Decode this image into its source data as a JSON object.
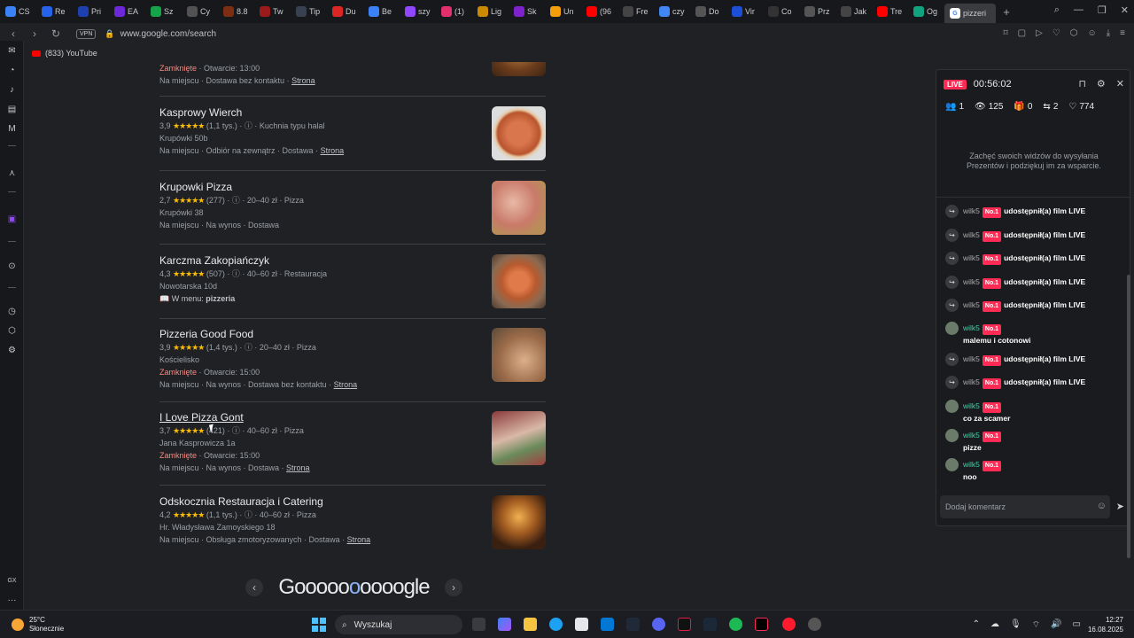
{
  "browser": {
    "tabs": [
      {
        "label": "CS",
        "color": "#3b82f6"
      },
      {
        "label": "Re",
        "color": "#2563eb"
      },
      {
        "label": "Pri",
        "color": "#1e40af"
      },
      {
        "label": "EA",
        "color": "#6d28d9"
      },
      {
        "label": "Sz",
        "color": "#16a34a"
      },
      {
        "label": "Cy",
        "color": "#525252"
      },
      {
        "label": "8.8",
        "color": "#7c2d12"
      },
      {
        "label": "Tw",
        "color": "#991b1b"
      },
      {
        "label": "Tip",
        "color": "#374151"
      },
      {
        "label": "Du",
        "color": "#dc2626"
      },
      {
        "label": "Be",
        "color": "#3b82f6"
      },
      {
        "label": "szy",
        "color": "#9146ff"
      },
      {
        "label": "(1)",
        "color": "#e1306c"
      },
      {
        "label": "Lig",
        "color": "#ca8a04"
      },
      {
        "label": "Sk",
        "color": "#7e22ce"
      },
      {
        "label": "Un",
        "color": "#f59e0b"
      },
      {
        "label": "(96",
        "color": "#ff0000"
      },
      {
        "label": "Fre",
        "color": "#444444"
      },
      {
        "label": "czy",
        "color": "#4285f4"
      },
      {
        "label": "Do",
        "color": "#555555"
      },
      {
        "label": "Vir",
        "color": "#1d4ed8"
      },
      {
        "label": "Co",
        "color": "#333333"
      },
      {
        "label": "Prz",
        "color": "#555555"
      },
      {
        "label": "Jak",
        "color": "#444444"
      },
      {
        "label": "Tre",
        "color": "#ff0000"
      },
      {
        "label": "Og",
        "color": "#10a37f"
      }
    ],
    "active_tab": "pizzeri",
    "new_tab": "+",
    "vpn": "VPN",
    "url": "www.google.com/search",
    "bookmark": "(833) YouTube"
  },
  "results": [
    {
      "name": "",
      "meta": "",
      "line1": "Zamknięte · Otwarcie: 13:00",
      "line2": "Na miejscu · Dostawa bez kontaktu",
      "link": "Strona"
    },
    {
      "name": "Kasprowy Wierch",
      "rating": "3,9",
      "stars": "★★★★★",
      "count": "(1,1 tys.)",
      "extra": "Kuchnia typu halal",
      "line1": "Krupówki 50b",
      "line2": "Na miejscu · Odbiór na zewnątrz · Dostawa",
      "link": "Strona"
    },
    {
      "name": "Krupowki Pizza",
      "rating": "2,7",
      "stars": "★★★★★",
      "count": "(277)",
      "extra": "20–40 zł · Pizza",
      "line1": "Krupówki 38",
      "line2": "Na miejscu · Na wynos · Dostawa",
      "link": ""
    },
    {
      "name": "Karczma Zakopiańczyk",
      "rating": "4,3",
      "stars": "★★★★★",
      "count": "(507)",
      "extra": "40–60 zł · Restauracja",
      "line1": "Nowotarska 10d",
      "menu_label": "W menu:",
      "menu_item": "pizzeria"
    },
    {
      "name": "Pizzeria Good Food",
      "rating": "3,9",
      "stars": "★★★★★",
      "count": "(1,4 tys.)",
      "extra": "20–40 zł · Pizza",
      "line1": "Kościelisko",
      "closed": "Zamknięte",
      "open": "· Otwarcie: 15:00",
      "line2": "Na miejscu · Na wynos · Dostawa bez kontaktu",
      "link": "Strona"
    },
    {
      "name": "I Love Pizza Gont",
      "rating": "3,7",
      "stars": "★★★★★",
      "count": "(421)",
      "extra": "40–60 zł · Pizza",
      "line1": "Jana Kasprowicza 1a",
      "closed": "Zamknięte",
      "open": "· Otwarcie: 15:00",
      "line2": "Na miejscu · Na wynos · Dostawa",
      "link": "Strona"
    },
    {
      "name": "Odskocznia Restauracja i Catering",
      "rating": "4,2",
      "stars": "★★★★★",
      "count": "(1,1 tys.)",
      "extra": "40–60 zł · Pizza",
      "line1": "Hr. Władysława Zamoyskiego 18",
      "line2": "Na miejscu · Obsługa zmotoryzowanych · Dostawa",
      "link": "Strona"
    }
  ],
  "first_closed": "Zamknięte",
  "first_open": "· Otwarcie: 13:00",
  "pager": {
    "logo_pre": "Gooooo",
    "logo_cur": "o",
    "logo_post": "oooogle",
    "prev": "‹",
    "next": "›"
  },
  "live": {
    "badge": "LIVE",
    "time": "00:56:02",
    "stats": {
      "users": "1",
      "views": "125",
      "gifts": "0",
      "shares": "2",
      "likes": "774"
    },
    "hint": "Zachęć swoich widzów do wysyłania Prezentów i podziękuj im za wsparcie.",
    "messages": [
      {
        "type": "share",
        "user": "wilk5",
        "badge": "No.1",
        "text": "udostępnił(a) film LIVE"
      },
      {
        "type": "share",
        "user": "wilk5",
        "badge": "No.1",
        "text": "udostępnił(a) film LIVE"
      },
      {
        "type": "share",
        "user": "wilk5",
        "badge": "No.1",
        "text": "udostępnił(a) film LIVE"
      },
      {
        "type": "share",
        "user": "wilk5",
        "badge": "No.1",
        "text": "udostępnił(a) film LIVE"
      },
      {
        "type": "share",
        "user": "wilk5",
        "badge": "No.1",
        "text": "udostępnił(a) film LIVE"
      },
      {
        "type": "chat",
        "user": "wilk5",
        "badge": "No.1",
        "text": "malemu i cotonowi"
      },
      {
        "type": "share",
        "user": "wilk5",
        "badge": "No.1",
        "text": "udostępnił(a) film LIVE"
      },
      {
        "type": "share",
        "user": "wilk5",
        "badge": "No.1",
        "text": "udostępnił(a) film LIVE"
      },
      {
        "type": "chat",
        "user": "wilk5",
        "badge": "No.1",
        "text": "co za scamer"
      },
      {
        "type": "chat",
        "user": "wilk5",
        "badge": "No.1",
        "text": "pizze"
      },
      {
        "type": "chat",
        "user": "wilk5",
        "badge": "No.1",
        "text": "noo"
      }
    ],
    "comment_placeholder": "Dodaj komentarz"
  },
  "taskbar": {
    "temp": "25°C",
    "weather": "Słonecznie",
    "search": "Wyszukaj",
    "time": "12:27",
    "date": "16.08.2025"
  },
  "sidebar_gx": "GX"
}
